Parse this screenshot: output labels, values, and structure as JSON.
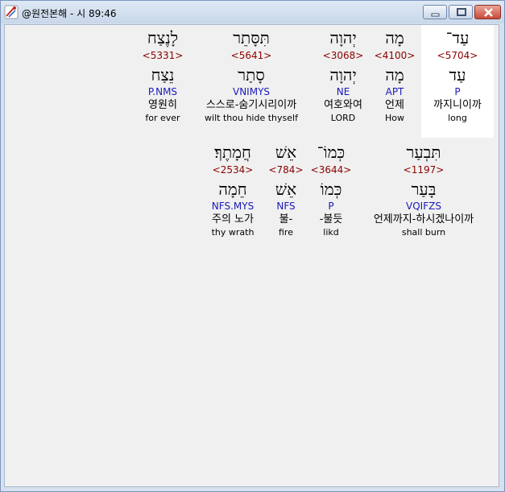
{
  "window": {
    "title": "@원전본해 - 시 89:46",
    "controls": {
      "minimize": "minimize",
      "maximize": "maximize",
      "close": "close"
    }
  },
  "colors": {
    "strong": "#8b0000",
    "morph": "#1a1ab8",
    "highlight_bg": "#ffffff",
    "client_bg": "#f0f0f0"
  },
  "rows": [
    {
      "words": [
        {
          "hebrew": "עַד־",
          "strong": "<5704>",
          "lexeme": "עַד",
          "morph": "P",
          "korean": "까지니이까",
          "english": "long"
        },
        {
          "hebrew": "מָה",
          "strong": "<4100>",
          "lexeme": "מָה",
          "morph": "APT",
          "korean": "언제",
          "english": "How"
        },
        {
          "hebrew": "יְהוָה",
          "strong": "<3068>",
          "lexeme": "יְהוָה",
          "morph": "NE",
          "korean": "여호와여",
          "english": "LORD"
        },
        {
          "hebrew": "תִּסָּתֵר",
          "strong": "<5641>",
          "lexeme": "סָתַר",
          "morph": "VNIMYS",
          "korean": "스스로-숨기시리이까",
          "english": "wilt thou hide thyself"
        },
        {
          "hebrew": "לָנֶצַח",
          "strong": "<5331>",
          "lexeme": "נֵצַח",
          "morph": "P.NMS",
          "korean": "영원히",
          "english": "for ever"
        }
      ]
    },
    {
      "words": [
        {
          "hebrew": "תִּבְעַר",
          "strong": "<1197>",
          "lexeme": "בָּעַר",
          "morph": "VQIFZS",
          "korean": "언제까지-하시겠나이까",
          "english": "shall burn"
        },
        {
          "hebrew": "כְּמוֹ־",
          "strong": "<3644>",
          "lexeme": "כְּמוֹ",
          "morph": "P",
          "korean": "-불듯",
          "english": "likd"
        },
        {
          "hebrew": "אֵשׁ",
          "strong": "<784>",
          "lexeme": "אֵשׁ",
          "morph": "NFS",
          "korean": "불-",
          "english": "fire"
        },
        {
          "hebrew": "חֲמָתֶךָ׃",
          "strong": "<2534>",
          "lexeme": "חֵמָה",
          "morph": "NFS.MYS",
          "korean": "주의 노가",
          "english": "thy wrath"
        }
      ]
    }
  ]
}
